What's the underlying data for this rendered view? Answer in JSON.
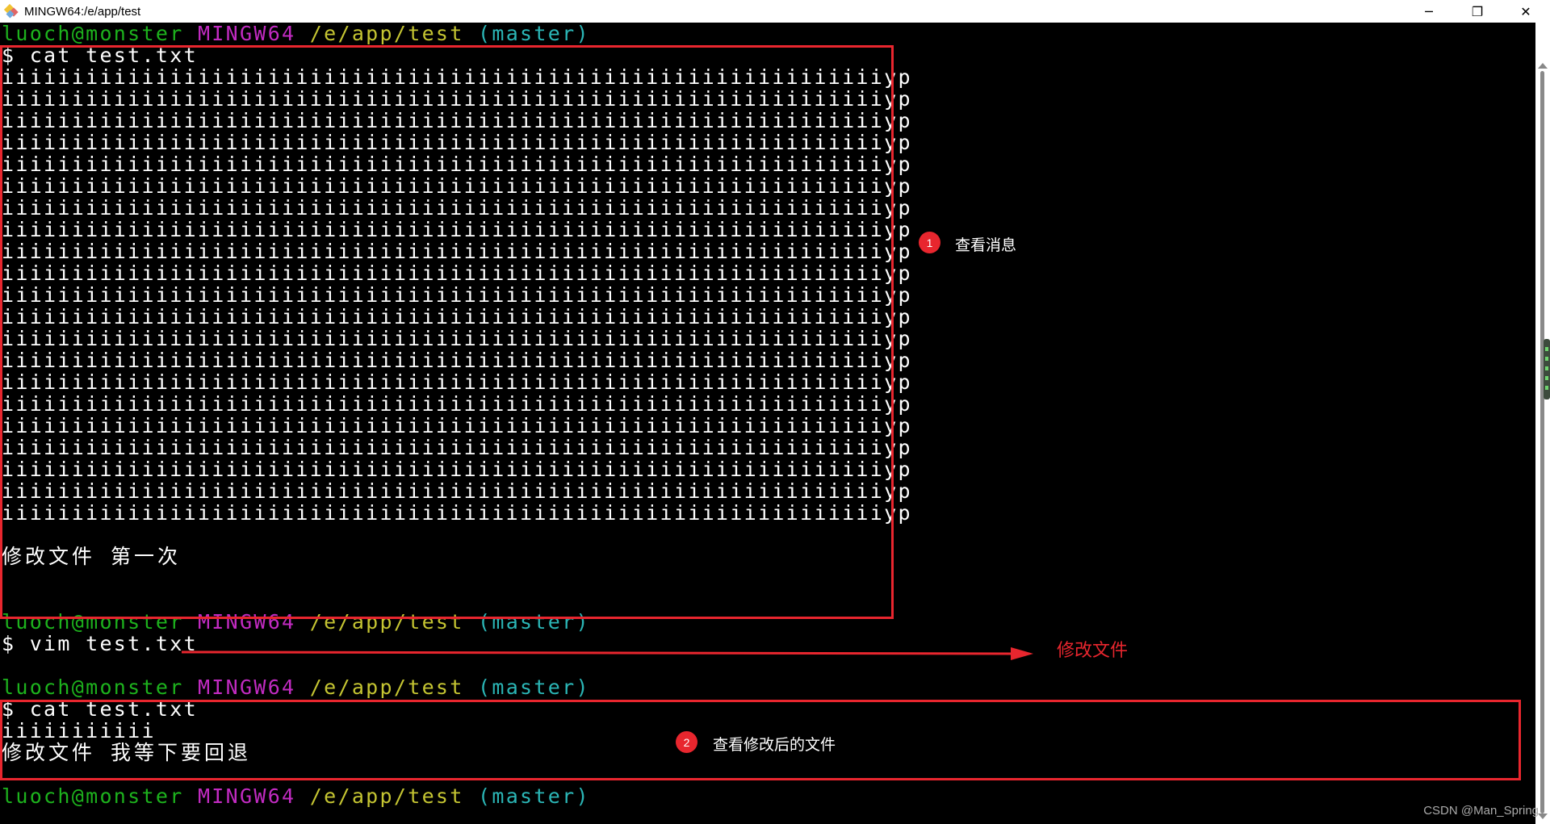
{
  "window": {
    "title": "MINGW64:/e/app/test",
    "minimize": "─",
    "restore": "❐",
    "close": "✕"
  },
  "prompt": {
    "user": "luoch@monster",
    "host": "MINGW64",
    "path": "/e/app/test",
    "branch": "(master)"
  },
  "terminal": {
    "cmd1": "$ cat test.txt",
    "file_line": "iiiiiiiiiiiiiiiiiiiiiiiiiiiiiiiiiiiiiiiiiiiiiiiiiiiiiiiiiiiiiiiyp",
    "commit_msg1": "修改文件 第一次",
    "cmd2": "$ vim test.txt",
    "cmd3": "$ cat test.txt",
    "file_line2": "iiiiiiiiiii",
    "commit_msg2": "修改文件 我等下要回退"
  },
  "annotations": {
    "badge1": "1",
    "note1": "查看消息",
    "arrow_note": "修改文件",
    "badge2": "2",
    "note2": "查看修改后的文件",
    "accent_color": "#e8262e"
  },
  "watermark": "CSDN @Man_Spring"
}
